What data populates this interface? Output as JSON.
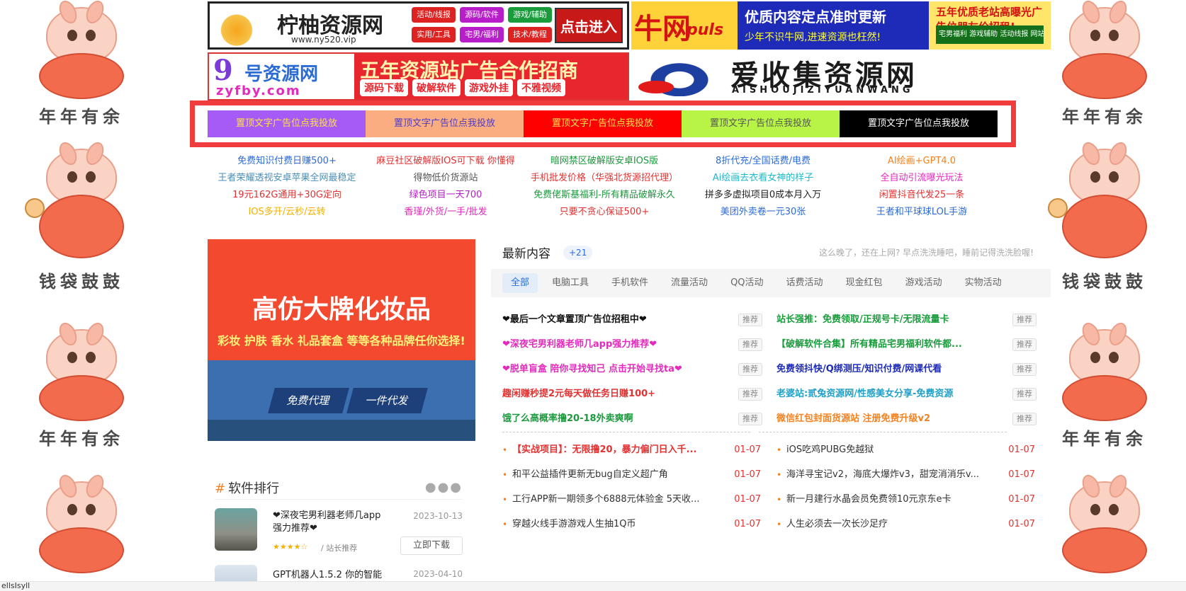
{
  "side_labels": {
    "top": "年年有余",
    "middle": "钱袋鼓鼓",
    "bottom": "年年有余"
  },
  "banners": {
    "b1": {
      "name": "柠柚资源网",
      "url": "www.ny520.vip",
      "tags": [
        "活动/线报",
        "源码/软件",
        "游戏/辅助",
        "实用/工具",
        "宅男/福利",
        "技术/教程"
      ],
      "enter": "点击进入"
    },
    "b2": {
      "niu": "牛网",
      "puls": "puls",
      "line1": "优质内容定点准时更新",
      "line2": "少年不识牛网,进速资源也枉然!",
      "line3": "五年优质老站高曝光广告位朋友价招租!",
      "line4": "宅男福利 游戏辅助 活动线报 网站源码 技术教程"
    },
    "b3": {
      "nine": "9",
      "site": "号资源网",
      "domain": "zyfby.com",
      "big": "五年资源站广告合作招商",
      "pills": [
        "源码下载",
        "破解软件",
        "游戏外挂",
        "不雅视频"
      ]
    },
    "b4": {
      "name": "爱收集资源网",
      "pinyin": "AISHOUJIZIYUANWANG"
    }
  },
  "text_ads": [
    {
      "label": "置顶文字广告位点我投放",
      "bg": "#a75bf6",
      "color": "#ffe14a"
    },
    {
      "label": "置顶文字广告位点我投放",
      "bg": "#fbad82",
      "color": "#4b3cc8"
    },
    {
      "label": "置顶文字广告位点我投放",
      "bg": "#ff0000",
      "color": "#ffe14a"
    },
    {
      "label": "置顶文字广告位点我投放",
      "bg": "#b7f446",
      "color": "#555555"
    },
    {
      "label": "置顶文字广告位点我投放",
      "bg": "#000000",
      "color": "#ffffff"
    }
  ],
  "links": [
    {
      "text": "免费知识付费日赚500+",
      "color": "#2b6bd6"
    },
    {
      "text": "麻豆社区破解版IOS可下载 你懂得",
      "color": "#e23232"
    },
    {
      "text": "暗网禁区破解版安卓IOS版",
      "color": "#1a9b3c"
    },
    {
      "text": "8折代充/全国话费/电费",
      "color": "#2b6bd6"
    },
    {
      "text": "AI绘画+GPT4.0",
      "color": "#f58220"
    },
    {
      "text": "王者荣耀透视安卓苹果全网最稳定",
      "color": "#4b8fb8"
    },
    {
      "text": "得物低价货源站",
      "color": "#555555"
    },
    {
      "text": "手机批发价格（华强北货源招代理）",
      "color": "#e23232"
    },
    {
      "text": "Ai绘画去衣看女神的样子",
      "color": "#20b8c8"
    },
    {
      "text": "全自动引流曝光玩法",
      "color": "#e22bbd"
    },
    {
      "text": "19元162G通用+30G定向",
      "color": "#e23232"
    },
    {
      "text": "绿色项目一天700",
      "color": "#b71ec9"
    },
    {
      "text": "免费佬斯基福利-所有精品破解永久",
      "color": "#1a9b3c"
    },
    {
      "text": "拼多多虚拟项目0成本月入万",
      "color": "#222222"
    },
    {
      "text": "闲置抖音代发25一条",
      "color": "#e23232"
    },
    {
      "text": "IOS多开/云秒/云转",
      "color": "#f3b200"
    },
    {
      "text": "香瑾/外货/一手/批发",
      "color": "#e22bbd"
    },
    {
      "text": "只要不贪心保证500+",
      "color": "#e23232"
    },
    {
      "text": "美团外卖卷一元30张",
      "color": "#2b6bd6"
    },
    {
      "text": "王者和平球球LOL手游",
      "color": "#2b6bd6"
    }
  ],
  "promo": {
    "title": "高仿大牌化妆品",
    "sub": "彩妆 护肤 香水 礼品套盒 等等各种品牌任你选择!",
    "btn1": "免费代理",
    "btn2": "一件代发"
  },
  "rank": {
    "title": "软件排行",
    "items": [
      {
        "name": "❤深夜宅男利器老师几app强力推荐❤",
        "date": "2023-10-13",
        "stars": "★★★★☆",
        "by": "/ 站长推荐",
        "download": "立即下载"
      },
      {
        "name": "GPT机器人1.5.2 你的智能",
        "date": "2023-04-10"
      }
    ]
  },
  "newest": {
    "title": "最新内容",
    "badge": "+21",
    "greet": "这么晚了，还在上网? 早点洗洗睡吧，睡前记得洗洗脸喔!",
    "tabs": [
      "全部",
      "电脑工具",
      "手机软件",
      "流量活动",
      "QQ活动",
      "话费活动",
      "现金红包",
      "游戏活动",
      "实物活动"
    ],
    "rec_label": "推荐",
    "pinned": [
      {
        "text": "❤最后一个文章置顶广告位招租中❤",
        "color": "#111111"
      },
      {
        "text": "站长强推：免费领取/正规号卡/无限流量卡",
        "color": "#1a9b3c"
      },
      {
        "text": "❤深夜宅男利器老师几app强力推荐❤",
        "color": "#e22bbd"
      },
      {
        "text": "【破解软件合集】所有精品宅男福利软件都...",
        "color": "#1a9b3c"
      },
      {
        "text": "❤脱单盲盒 陪你寻找知己 点击开始寻找ta❤",
        "color": "#e22bbd"
      },
      {
        "text": "免费领抖快/Q绑测压/知识付费/网课代看",
        "color": "#1e2bb8"
      },
      {
        "text": "趣闲赚秒提2元每天做任务日赚100+",
        "color": "#e23232"
      },
      {
        "text": "老婆站:贰兔资源网/性感美女分享-免费资源",
        "color": "#20a0c8"
      },
      {
        "text": "饿了么高概率撸20-18外卖爽啊",
        "color": "#1a9b3c"
      },
      {
        "text": "微信红包封面货源站 注册免费升级v2",
        "color": "#f58220"
      }
    ],
    "list": [
      {
        "text": "【实战项目】：无限撸20，暴力偏门日入千...",
        "date": "01-07",
        "highlight": true
      },
      {
        "text": "iOS吃鸡PUBG免越狱",
        "date": "01-07"
      },
      {
        "text": "和平公益插件更新无bug自定义超广角",
        "date": "01-07"
      },
      {
        "text": "海洋寻宝记v2，海底大爆炸v3，甜宠消消乐v...",
        "date": "01-07"
      },
      {
        "text": "工行APP新一期领多个6888元体验金 5天收...",
        "date": "01-07"
      },
      {
        "text": "新一月建行水晶会员免费领10元京东e卡",
        "date": "01-07"
      },
      {
        "text": "穿越火线手游游戏人生抽1Q币",
        "date": "01-07"
      },
      {
        "text": "人生必须去一次长沙足疗",
        "date": "01-07"
      }
    ]
  },
  "bottom_strip": "ellsIsyll"
}
